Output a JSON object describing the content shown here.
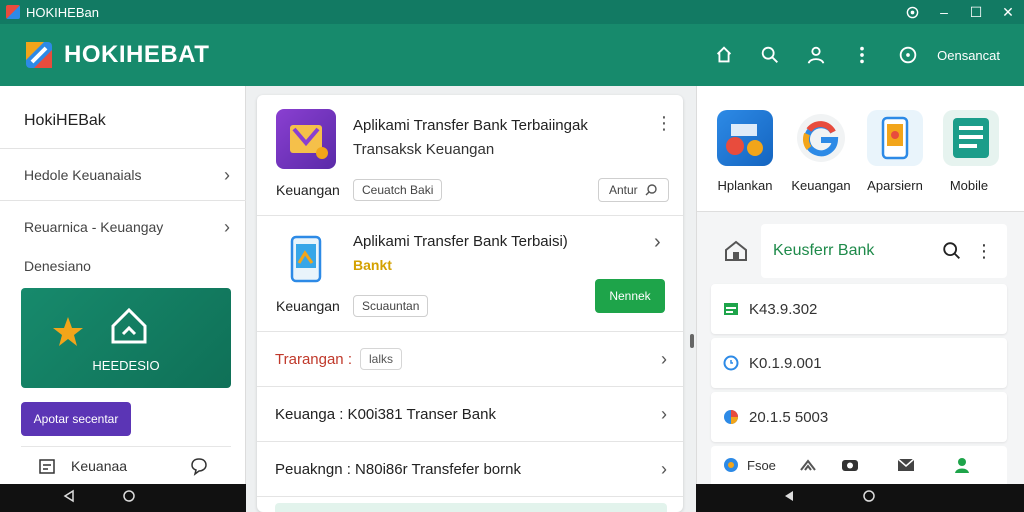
{
  "window": {
    "title": "HOKIHEBan",
    "minimize": "–",
    "maximize": "☐",
    "close": "✕"
  },
  "header": {
    "brand": "HOKIHEBAT",
    "right_label": "Oensancat",
    "icons": [
      "home-icon",
      "search-icon",
      "user-icon",
      "more-icon",
      "circle-icon"
    ]
  },
  "sidebar": {
    "title": "HokiHEBak",
    "items": [
      {
        "label": "Hedole Keuanaials"
      },
      {
        "label": "Reuarnica - Keuangay"
      }
    ],
    "plain": "Denesiano",
    "promo_text": "HEEDESIO",
    "button": "Apotar secentar",
    "bottom_label": "Keuanaa"
  },
  "center": {
    "app1": {
      "title": "Aplikami Transfer Bank Terbaiingak",
      "subtitle": "Transaksk Keuangan",
      "category": "Keuangan",
      "chip": "Ceuatch Baki",
      "action": "Antur"
    },
    "app2": {
      "title": "Aplikami Transfer Bank Terbaisi)",
      "subtitle": "Bankt",
      "category": "Keuangan",
      "chip": "Scuauntan",
      "button": "Nennek"
    },
    "rows": [
      {
        "label": "Trarangan :",
        "chip": "lalks"
      },
      {
        "label": "Keuanga :  K00i381 Transer Bank"
      },
      {
        "label": "Peuakngn :  N80i86r Transfefer bornk"
      }
    ]
  },
  "right": {
    "apps": [
      {
        "label": "Hplankan"
      },
      {
        "label": "Keuangan"
      },
      {
        "label": "Aparsiern"
      },
      {
        "label": "Mobile"
      }
    ],
    "search_text": "Keusferr Bank",
    "cards": [
      {
        "value": "K43.9.302"
      },
      {
        "value": "K0.1.9.001"
      },
      {
        "value": "20.1.5 5003"
      }
    ],
    "bottom_label": "Fsoe"
  },
  "colors": {
    "brand_green": "#178a6c",
    "accent_purple": "#5b35b5",
    "button_green": "#1ea44a"
  }
}
